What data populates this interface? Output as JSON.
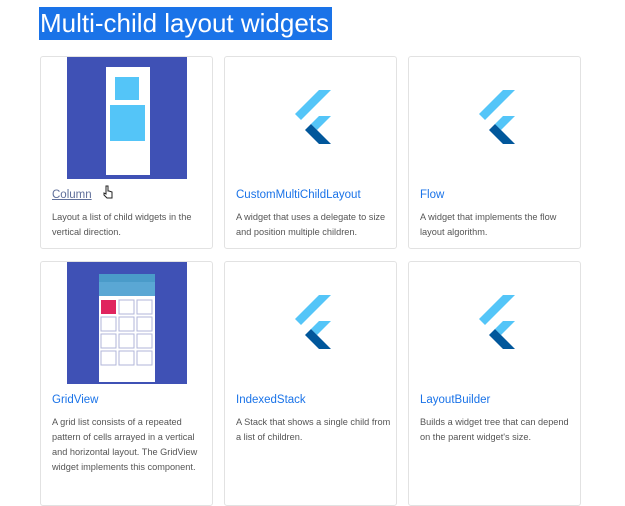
{
  "page": {
    "heading": "Multi-child layout widgets"
  },
  "cards": [
    {
      "title": "Column",
      "description": "Layout a list of child widgets in the vertical direction.",
      "image": "column-illustration"
    },
    {
      "title": "CustomMultiChildLayout",
      "description": "A widget that uses a delegate to size and position multiple children.",
      "image": "flutter-logo-icon"
    },
    {
      "title": "Flow",
      "description": "A widget that implements the flow layout algorithm.",
      "image": "flutter-logo-icon"
    },
    {
      "title": "GridView",
      "description": "A grid list consists of a repeated pattern of cells arrayed in a vertical and horizontal layout. The GridView widget implements this component.",
      "image": "gridview-illustration"
    },
    {
      "title": "IndexedStack",
      "description": "A Stack that shows a single child from a list of children.",
      "image": "flutter-logo-icon"
    },
    {
      "title": "LayoutBuilder",
      "description": "Builds a widget tree that can depend on the parent widget's size.",
      "image": "flutter-logo-icon"
    }
  ],
  "colors": {
    "heading_highlight": "#1a73e8",
    "link": "#1a73e8",
    "illustration_bg": "#3f51b5",
    "flutter_light": "#54c5f8",
    "flutter_dark": "#01579b"
  }
}
